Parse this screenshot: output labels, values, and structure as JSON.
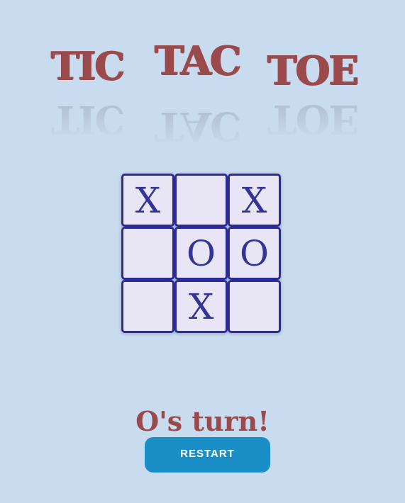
{
  "title": {
    "words": [
      "TIC",
      "TAC",
      "TOE"
    ]
  },
  "board": {
    "cells": [
      "X",
      "",
      "X",
      "",
      "O",
      "O",
      "",
      "X",
      ""
    ]
  },
  "status": "O's turn!",
  "restart_label": "RESTART",
  "colors": {
    "background": "#c9dbee",
    "title": "#9b4a4c",
    "cell_border": "#2b2b9a",
    "cell_fill": "#e8e6f5",
    "mark": "#33339a",
    "button": "#1a8fc7"
  }
}
